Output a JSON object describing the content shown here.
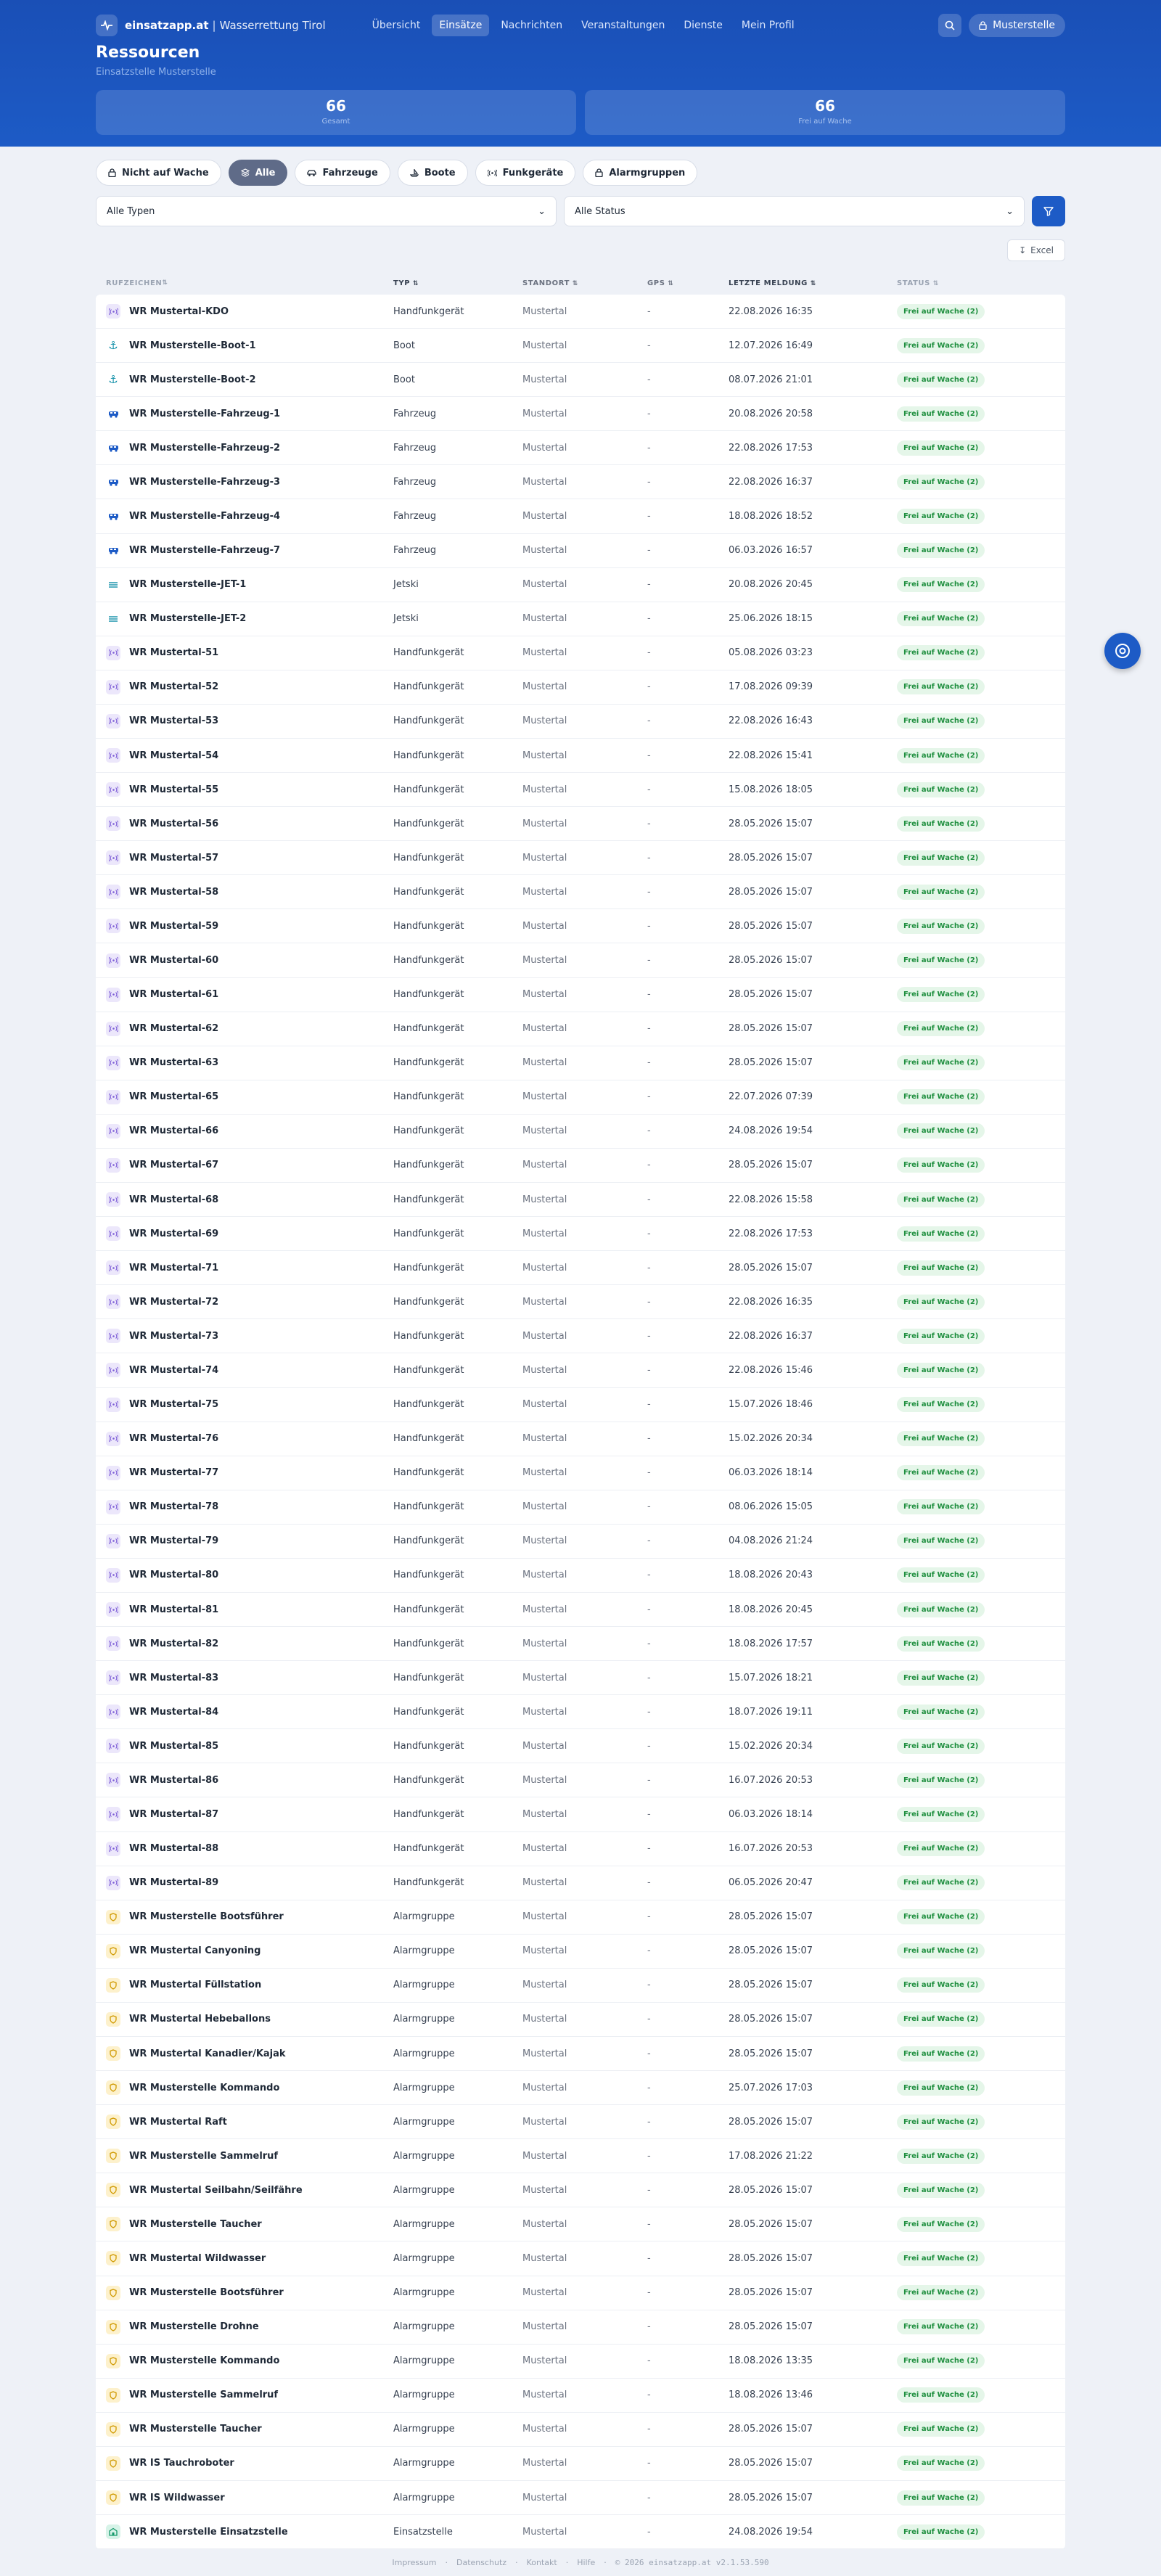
{
  "brand": {
    "name": "einsatzapp.at",
    "separator": "|",
    "org": "Wasserrettung Tirol"
  },
  "nav": [
    {
      "label": "Übersicht",
      "active": false
    },
    {
      "label": "Einsätze",
      "active": true
    },
    {
      "label": "Nachrichten",
      "active": false
    },
    {
      "label": "Veranstaltungen",
      "active": false
    },
    {
      "label": "Dienste",
      "active": false
    },
    {
      "label": "Mein Profil",
      "active": false
    }
  ],
  "user": {
    "label": "Musterstelle"
  },
  "page": {
    "title": "Ressourcen",
    "subtitle": "Einsatzstelle Musterstelle"
  },
  "stats": [
    {
      "value": "66",
      "label": "Gesamt"
    },
    {
      "value": "66",
      "label": "Frei auf Wache"
    }
  ],
  "filters": [
    {
      "label": "Nicht auf Wache",
      "icon": "lock-icon",
      "active": false
    },
    {
      "label": "Alle",
      "icon": "layers-icon",
      "active": true
    },
    {
      "label": "Fahrzeuge",
      "icon": "car-icon",
      "active": false
    },
    {
      "label": "Boote",
      "icon": "boat-icon",
      "active": false
    },
    {
      "label": "Funkgeräte",
      "icon": "radio-icon",
      "active": false
    },
    {
      "label": "Alarmgruppen",
      "icon": "lock-icon",
      "active": false
    }
  ],
  "selects": {
    "type": "Alle Typen",
    "status": "Alle Status"
  },
  "excel_label": "Excel",
  "columns": [
    "RUFZEICHEN",
    "TYP",
    "STANDORT",
    "GPS",
    "LETZTE MELDUNG",
    "STATUS"
  ],
  "status_badge": "Frei auf Wache (2)",
  "rows": [
    {
      "icon": "radio",
      "name": "WR Mustertal-KDO",
      "type": "Handfunkgerät",
      "location": "Mustertal",
      "gps": "-",
      "last": "22.08.2026 16:35"
    },
    {
      "icon": "boat",
      "name": "WR Musterstelle-Boot-1",
      "type": "Boot",
      "location": "Mustertal",
      "gps": "-",
      "last": "12.07.2026 16:49"
    },
    {
      "icon": "boat",
      "name": "WR Musterstelle-Boot-2",
      "type": "Boot",
      "location": "Mustertal",
      "gps": "-",
      "last": "08.07.2026 21:01"
    },
    {
      "icon": "car",
      "name": "WR Musterstelle-Fahrzeug-1",
      "type": "Fahrzeug",
      "location": "Mustertal",
      "gps": "-",
      "last": "20.08.2026 20:58"
    },
    {
      "icon": "car",
      "name": "WR Musterstelle-Fahrzeug-2",
      "type": "Fahrzeug",
      "location": "Mustertal",
      "gps": "-",
      "last": "22.08.2026 17:53"
    },
    {
      "icon": "car",
      "name": "WR Musterstelle-Fahrzeug-3",
      "type": "Fahrzeug",
      "location": "Mustertal",
      "gps": "-",
      "last": "22.08.2026 16:37"
    },
    {
      "icon": "car",
      "name": "WR Musterstelle-Fahrzeug-4",
      "type": "Fahrzeug",
      "location": "Mustertal",
      "gps": "-",
      "last": "18.08.2026 18:52"
    },
    {
      "icon": "car",
      "name": "WR Musterstelle-Fahrzeug-7",
      "type": "Fahrzeug",
      "location": "Mustertal",
      "gps": "-",
      "last": "06.03.2026 16:57"
    },
    {
      "icon": "jet",
      "name": "WR Musterstelle-JET-1",
      "type": "Jetski",
      "location": "Mustertal",
      "gps": "-",
      "last": "20.08.2026 20:45"
    },
    {
      "icon": "jet",
      "name": "WR Musterstelle-JET-2",
      "type": "Jetski",
      "location": "Mustertal",
      "gps": "-",
      "last": "25.06.2026 18:15"
    },
    {
      "icon": "radio",
      "name": "WR Mustertal-51",
      "type": "Handfunkgerät",
      "location": "Mustertal",
      "gps": "-",
      "last": "05.08.2026 03:23"
    },
    {
      "icon": "radio",
      "name": "WR Mustertal-52",
      "type": "Handfunkgerät",
      "location": "Mustertal",
      "gps": "-",
      "last": "17.08.2026 09:39"
    },
    {
      "icon": "radio",
      "name": "WR Mustertal-53",
      "type": "Handfunkgerät",
      "location": "Mustertal",
      "gps": "-",
      "last": "22.08.2026 16:43"
    },
    {
      "icon": "radio",
      "name": "WR Mustertal-54",
      "type": "Handfunkgerät",
      "location": "Mustertal",
      "gps": "-",
      "last": "22.08.2026 15:41"
    },
    {
      "icon": "radio",
      "name": "WR Mustertal-55",
      "type": "Handfunkgerät",
      "location": "Mustertal",
      "gps": "-",
      "last": "15.08.2026 18:05"
    },
    {
      "icon": "radio",
      "name": "WR Mustertal-56",
      "type": "Handfunkgerät",
      "location": "Mustertal",
      "gps": "-",
      "last": "28.05.2026 15:07"
    },
    {
      "icon": "radio",
      "name": "WR Mustertal-57",
      "type": "Handfunkgerät",
      "location": "Mustertal",
      "gps": "-",
      "last": "28.05.2026 15:07"
    },
    {
      "icon": "radio",
      "name": "WR Mustertal-58",
      "type": "Handfunkgerät",
      "location": "Mustertal",
      "gps": "-",
      "last": "28.05.2026 15:07"
    },
    {
      "icon": "radio",
      "name": "WR Mustertal-59",
      "type": "Handfunkgerät",
      "location": "Mustertal",
      "gps": "-",
      "last": "28.05.2026 15:07"
    },
    {
      "icon": "radio",
      "name": "WR Mustertal-60",
      "type": "Handfunkgerät",
      "location": "Mustertal",
      "gps": "-",
      "last": "28.05.2026 15:07"
    },
    {
      "icon": "radio",
      "name": "WR Mustertal-61",
      "type": "Handfunkgerät",
      "location": "Mustertal",
      "gps": "-",
      "last": "28.05.2026 15:07"
    },
    {
      "icon": "radio",
      "name": "WR Mustertal-62",
      "type": "Handfunkgerät",
      "location": "Mustertal",
      "gps": "-",
      "last": "28.05.2026 15:07"
    },
    {
      "icon": "radio",
      "name": "WR Mustertal-63",
      "type": "Handfunkgerät",
      "location": "Mustertal",
      "gps": "-",
      "last": "28.05.2026 15:07"
    },
    {
      "icon": "radio",
      "name": "WR Mustertal-65",
      "type": "Handfunkgerät",
      "location": "Mustertal",
      "gps": "-",
      "last": "22.07.2026 07:39"
    },
    {
      "icon": "radio",
      "name": "WR Mustertal-66",
      "type": "Handfunkgerät",
      "location": "Mustertal",
      "gps": "-",
      "last": "24.08.2026 19:54"
    },
    {
      "icon": "radio",
      "name": "WR Mustertal-67",
      "type": "Handfunkgerät",
      "location": "Mustertal",
      "gps": "-",
      "last": "28.05.2026 15:07"
    },
    {
      "icon": "radio",
      "name": "WR Mustertal-68",
      "type": "Handfunkgerät",
      "location": "Mustertal",
      "gps": "-",
      "last": "22.08.2026 15:58"
    },
    {
      "icon": "radio",
      "name": "WR Mustertal-69",
      "type": "Handfunkgerät",
      "location": "Mustertal",
      "gps": "-",
      "last": "22.08.2026 17:53"
    },
    {
      "icon": "radio",
      "name": "WR Mustertal-71",
      "type": "Handfunkgerät",
      "location": "Mustertal",
      "gps": "-",
      "last": "28.05.2026 15:07"
    },
    {
      "icon": "radio",
      "name": "WR Mustertal-72",
      "type": "Handfunkgerät",
      "location": "Mustertal",
      "gps": "-",
      "last": "22.08.2026 16:35"
    },
    {
      "icon": "radio",
      "name": "WR Mustertal-73",
      "type": "Handfunkgerät",
      "location": "Mustertal",
      "gps": "-",
      "last": "22.08.2026 16:37"
    },
    {
      "icon": "radio",
      "name": "WR Mustertal-74",
      "type": "Handfunkgerät",
      "location": "Mustertal",
      "gps": "-",
      "last": "22.08.2026 15:46"
    },
    {
      "icon": "radio",
      "name": "WR Mustertal-75",
      "type": "Handfunkgerät",
      "location": "Mustertal",
      "gps": "-",
      "last": "15.07.2026 18:46"
    },
    {
      "icon": "radio",
      "name": "WR Mustertal-76",
      "type": "Handfunkgerät",
      "location": "Mustertal",
      "gps": "-",
      "last": "15.02.2026 20:34"
    },
    {
      "icon": "radio",
      "name": "WR Mustertal-77",
      "type": "Handfunkgerät",
      "location": "Mustertal",
      "gps": "-",
      "last": "06.03.2026 18:14"
    },
    {
      "icon": "radio",
      "name": "WR Mustertal-78",
      "type": "Handfunkgerät",
      "location": "Mustertal",
      "gps": "-",
      "last": "08.06.2026 15:05"
    },
    {
      "icon": "radio",
      "name": "WR Mustertal-79",
      "type": "Handfunkgerät",
      "location": "Mustertal",
      "gps": "-",
      "last": "04.08.2026 21:24"
    },
    {
      "icon": "radio",
      "name": "WR Mustertal-80",
      "type": "Handfunkgerät",
      "location": "Mustertal",
      "gps": "-",
      "last": "18.08.2026 20:43"
    },
    {
      "icon": "radio",
      "name": "WR Mustertal-81",
      "type": "Handfunkgerät",
      "location": "Mustertal",
      "gps": "-",
      "last": "18.08.2026 20:45"
    },
    {
      "icon": "radio",
      "name": "WR Mustertal-82",
      "type": "Handfunkgerät",
      "location": "Mustertal",
      "gps": "-",
      "last": "18.08.2026 17:57"
    },
    {
      "icon": "radio",
      "name": "WR Mustertal-83",
      "type": "Handfunkgerät",
      "location": "Mustertal",
      "gps": "-",
      "last": "15.07.2026 18:21"
    },
    {
      "icon": "radio",
      "name": "WR Mustertal-84",
      "type": "Handfunkgerät",
      "location": "Mustertal",
      "gps": "-",
      "last": "18.07.2026 19:11"
    },
    {
      "icon": "radio",
      "name": "WR Mustertal-85",
      "type": "Handfunkgerät",
      "location": "Mustertal",
      "gps": "-",
      "last": "15.02.2026 20:34"
    },
    {
      "icon": "radio",
      "name": "WR Mustertal-86",
      "type": "Handfunkgerät",
      "location": "Mustertal",
      "gps": "-",
      "last": "16.07.2026 20:53"
    },
    {
      "icon": "radio",
      "name": "WR Mustertal-87",
      "type": "Handfunkgerät",
      "location": "Mustertal",
      "gps": "-",
      "last": "06.03.2026 18:14"
    },
    {
      "icon": "radio",
      "name": "WR Mustertal-88",
      "type": "Handfunkgerät",
      "location": "Mustertal",
      "gps": "-",
      "last": "16.07.2026 20:53"
    },
    {
      "icon": "radio",
      "name": "WR Mustertal-89",
      "type": "Handfunkgerät",
      "location": "Mustertal",
      "gps": "-",
      "last": "06.05.2026 20:47"
    },
    {
      "icon": "group",
      "name": "WR Musterstelle Bootsführer",
      "type": "Alarmgruppe",
      "location": "Mustertal",
      "gps": "-",
      "last": "28.05.2026 15:07"
    },
    {
      "icon": "group",
      "name": "WR Mustertal Canyoning",
      "type": "Alarmgruppe",
      "location": "Mustertal",
      "gps": "-",
      "last": "28.05.2026 15:07"
    },
    {
      "icon": "group",
      "name": "WR Mustertal Füllstation",
      "type": "Alarmgruppe",
      "location": "Mustertal",
      "gps": "-",
      "last": "28.05.2026 15:07"
    },
    {
      "icon": "group",
      "name": "WR Mustertal Hebeballons",
      "type": "Alarmgruppe",
      "location": "Mustertal",
      "gps": "-",
      "last": "28.05.2026 15:07"
    },
    {
      "icon": "group",
      "name": "WR Mustertal Kanadier/Kajak",
      "type": "Alarmgruppe",
      "location": "Mustertal",
      "gps": "-",
      "last": "28.05.2026 15:07"
    },
    {
      "icon": "group",
      "name": "WR Musterstelle Kommando",
      "type": "Alarmgruppe",
      "location": "Mustertal",
      "gps": "-",
      "last": "25.07.2026 17:03"
    },
    {
      "icon": "group",
      "name": "WR Mustertal Raft",
      "type": "Alarmgruppe",
      "location": "Mustertal",
      "gps": "-",
      "last": "28.05.2026 15:07"
    },
    {
      "icon": "group",
      "name": "WR Musterstelle Sammelruf",
      "type": "Alarmgruppe",
      "location": "Mustertal",
      "gps": "-",
      "last": "17.08.2026 21:22"
    },
    {
      "icon": "group",
      "name": "WR Mustertal Seilbahn/Seilfähre",
      "type": "Alarmgruppe",
      "location": "Mustertal",
      "gps": "-",
      "last": "28.05.2026 15:07"
    },
    {
      "icon": "group",
      "name": "WR Musterstelle Taucher",
      "type": "Alarmgruppe",
      "location": "Mustertal",
      "gps": "-",
      "last": "28.05.2026 15:07"
    },
    {
      "icon": "group",
      "name": "WR Mustertal Wildwasser",
      "type": "Alarmgruppe",
      "location": "Mustertal",
      "gps": "-",
      "last": "28.05.2026 15:07"
    },
    {
      "icon": "group",
      "name": "WR Musterstelle Bootsführer",
      "type": "Alarmgruppe",
      "location": "Mustertal",
      "gps": "-",
      "last": "28.05.2026 15:07"
    },
    {
      "icon": "group",
      "name": "WR Musterstelle Drohne",
      "type": "Alarmgruppe",
      "location": "Mustertal",
      "gps": "-",
      "last": "28.05.2026 15:07"
    },
    {
      "icon": "group",
      "name": "WR Musterstelle Kommando",
      "type": "Alarmgruppe",
      "location": "Mustertal",
      "gps": "-",
      "last": "18.08.2026 13:35"
    },
    {
      "icon": "group",
      "name": "WR Musterstelle Sammelruf",
      "type": "Alarmgruppe",
      "location": "Mustertal",
      "gps": "-",
      "last": "18.08.2026 13:46"
    },
    {
      "icon": "group",
      "name": "WR Musterstelle Taucher",
      "type": "Alarmgruppe",
      "location": "Mustertal",
      "gps": "-",
      "last": "28.05.2026 15:07"
    },
    {
      "icon": "group",
      "name": "WR IS Tauchroboter",
      "type": "Alarmgruppe",
      "location": "Mustertal",
      "gps": "-",
      "last": "28.05.2026 15:07"
    },
    {
      "icon": "group",
      "name": "WR IS Wildwasser",
      "type": "Alarmgruppe",
      "location": "Mustertal",
      "gps": "-",
      "last": "28.05.2026 15:07"
    },
    {
      "icon": "station",
      "name": "WR Musterstelle Einsatzstelle",
      "type": "Einsatzstelle",
      "location": "Mustertal",
      "gps": "-",
      "last": "24.08.2026 19:54"
    }
  ],
  "footer": [
    "Impressum",
    "Datenschutz",
    "Kontakt",
    "Hilfe",
    "© 2026 einsatzapp.at  v2.1.53.590"
  ]
}
